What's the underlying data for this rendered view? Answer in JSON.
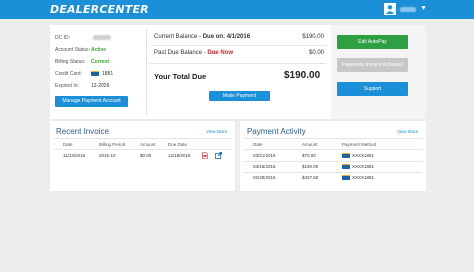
{
  "header": {
    "logo": "DEALERCENTER",
    "user_icon": "user-icon",
    "caret_icon": "caret-down-icon"
  },
  "account": {
    "dc_id_label": "DC ID:",
    "status_label": "Account Status:",
    "status_value": "Active",
    "billing_label": "Billing Status:",
    "billing_value": "Current",
    "card_label": "Credit Card:",
    "card_value": "1881",
    "expired_label": "Expired In:",
    "expired_value": "12-2026",
    "manage_button": "Manage Payment Account"
  },
  "balance": {
    "current_label": "Current Balance - ",
    "due_on": "Due on: 4/1/2016",
    "current_value": "$190.00",
    "past_due_label": "Past Due Balance - ",
    "due_now": "Due Now",
    "past_due_value": "$0.00",
    "total_label": "Your Total Due",
    "total_value": "$190.00",
    "make_payment": "Make Payment"
  },
  "actions": {
    "autopay": "Edit AutoPay",
    "invoice": "Paperless Invoice Activated",
    "support": "Support"
  },
  "colors": {
    "brand": "#1b8fd8",
    "green": "#3aa43a",
    "red": "#d9202c"
  },
  "recent_invoice": {
    "title": "Recent Invoice",
    "view_more": "View More",
    "headers": [
      "Date",
      "Billing Period",
      "Amount",
      "Due Date"
    ],
    "row": {
      "date": "11/13/2015",
      "period": "2015-10",
      "amount": "$0.00",
      "due": "12/18/2015",
      "pdf_icon": "pdf-icon",
      "open_icon": "open-link-icon"
    }
  },
  "payment_activity": {
    "title": "Payment Activity",
    "view_more": "View More",
    "headers": [
      "Date",
      "Amount",
      "Payment Method"
    ],
    "rows": [
      {
        "date": "03/21/2016",
        "amount": "$70.00",
        "method": "XXXX1881"
      },
      {
        "date": "03/15/2016",
        "amount": "$190.00",
        "method": "XXXX1881"
      },
      {
        "date": "02/29/2016",
        "amount": "$437.50",
        "method": "XXXX1881"
      }
    ]
  }
}
